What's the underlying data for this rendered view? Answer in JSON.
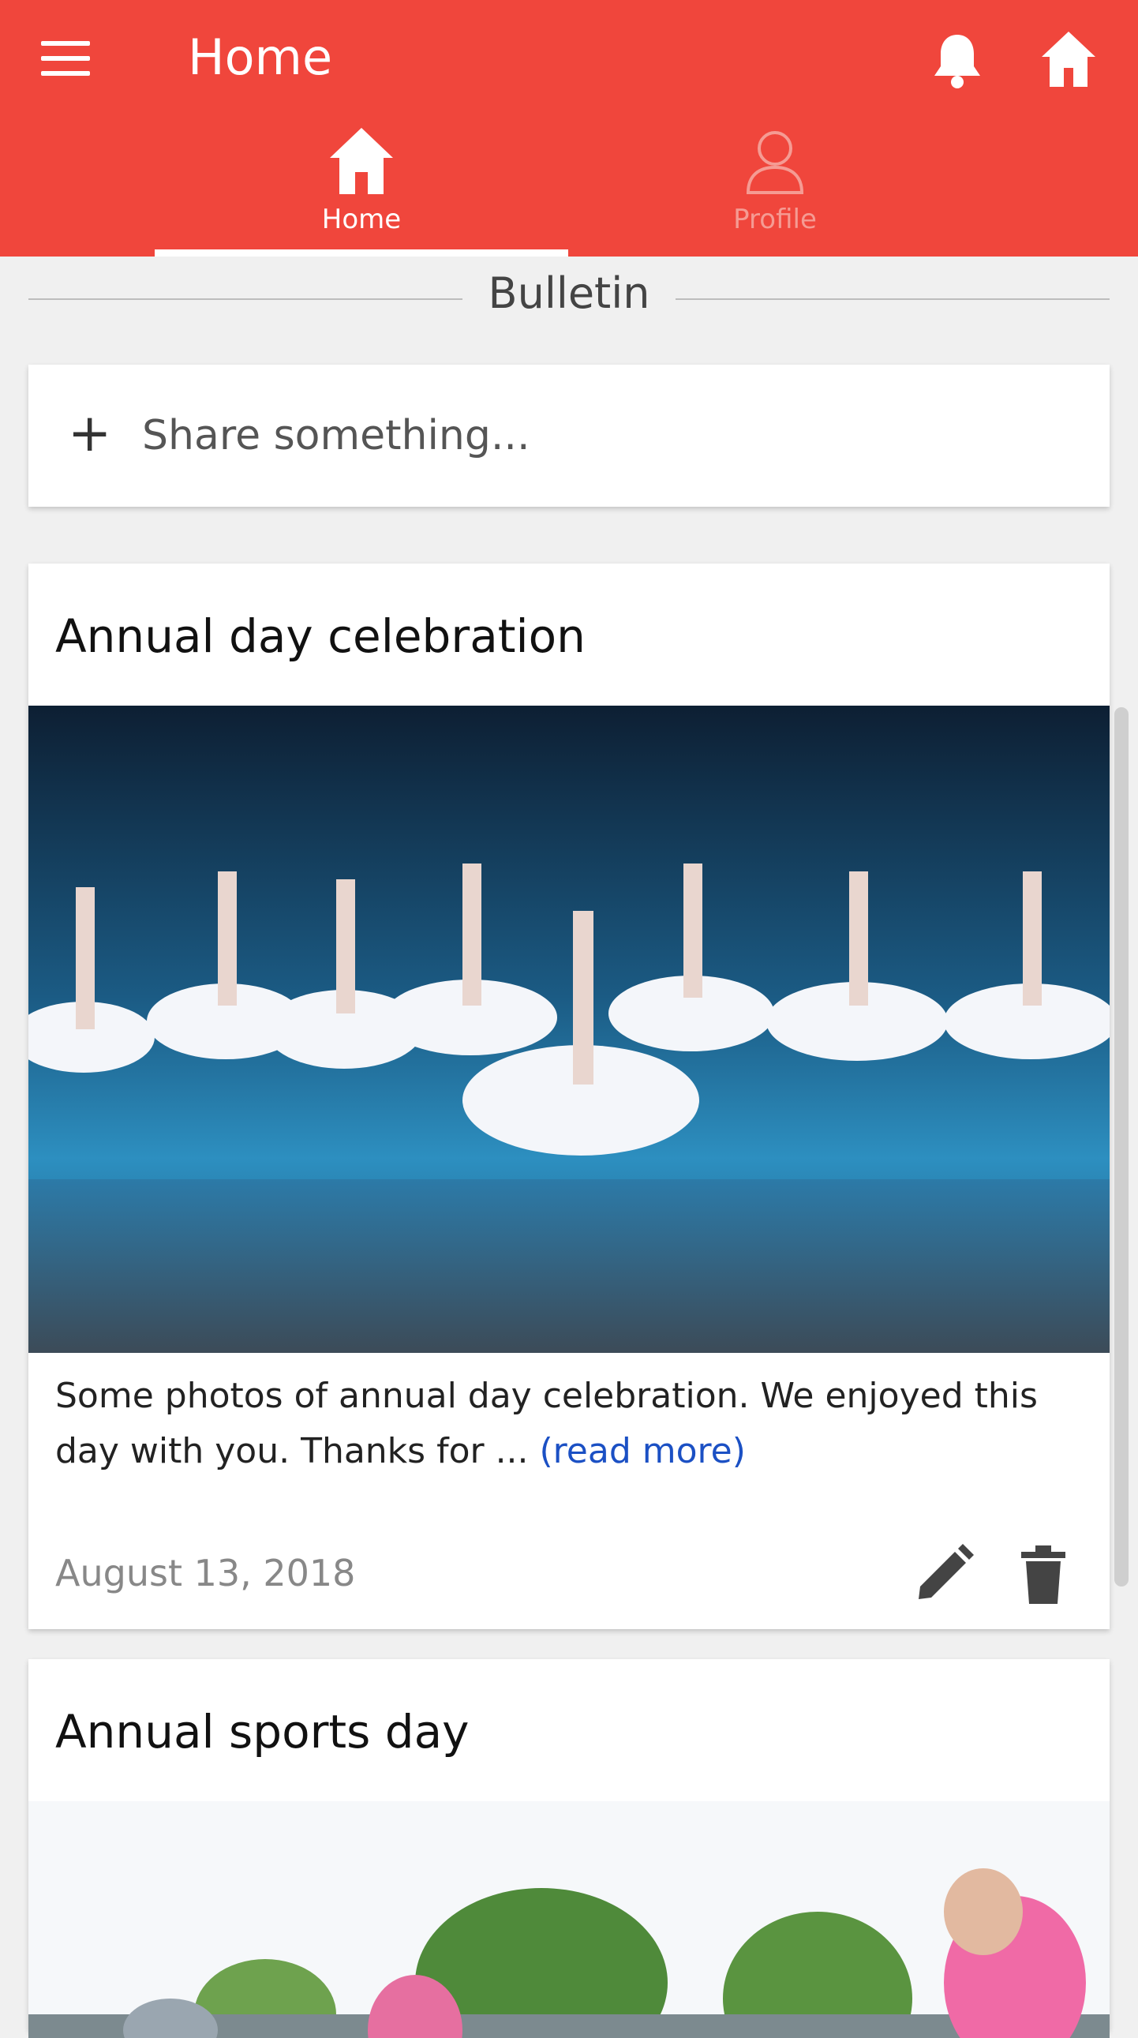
{
  "appbar": {
    "title": "Home",
    "icons": [
      "menu-icon",
      "bell-icon",
      "home-icon"
    ],
    "color": "#f0463c"
  },
  "tabs": [
    {
      "label": "Home",
      "icon": "home-icon",
      "active": true
    },
    {
      "label": "Profile",
      "icon": "person-icon",
      "active": false
    }
  ],
  "section": {
    "title": "Bulletin"
  },
  "share": {
    "placeholder": "Share something..."
  },
  "posts": [
    {
      "title": "Annual day celebration",
      "image": "ballet-dancers-photo",
      "excerpt": "Some photos of annual day celebration. We enjoyed this day with you. Thanks for ... ",
      "read_more": "(read more)",
      "date": "August 13, 2018"
    },
    {
      "title": "Annual sports day",
      "image": "children-outdoors-photo"
    }
  ],
  "link_color": "#1b50c4"
}
